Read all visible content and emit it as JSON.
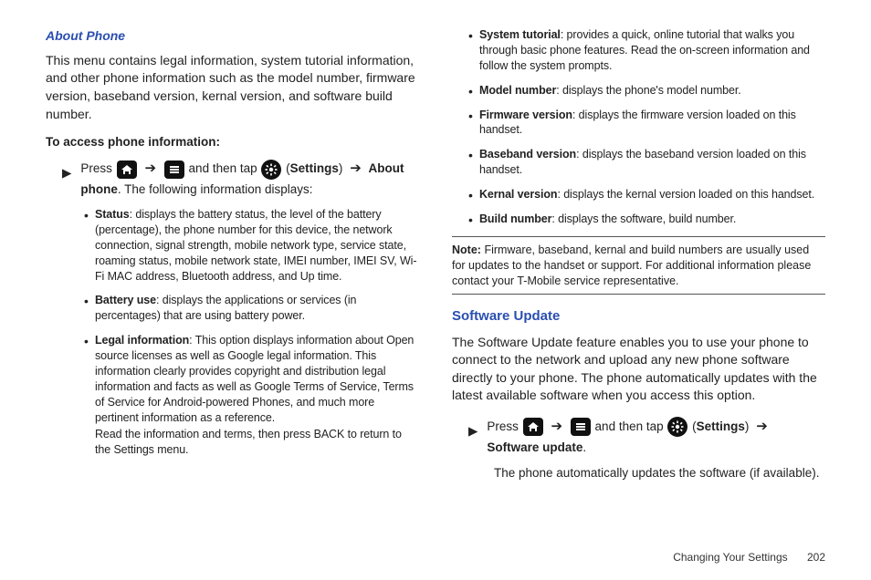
{
  "left": {
    "heading": "About Phone",
    "intro": "This menu contains legal information, system tutorial information, and other phone information such as the model number, firmware version, baseband version, kernal version, and software build number.",
    "access_heading": "To access phone information:",
    "press": "Press",
    "and_then_tap": "and then tap",
    "paren_open": "(",
    "settings_label": "Settings",
    "paren_close": ")",
    "arrow": "➔",
    "about_phone_bold": "About phone",
    "following": ". The following information displays:",
    "bullets": [
      {
        "title": "Status",
        "text": ": displays the battery status, the level of the battery (percentage), the phone number for this device, the network connection, signal strength, mobile network type, service state, roaming status, mobile network state, IMEI number, IMEI SV, Wi-Fi MAC address, Bluetooth address, and Up time."
      },
      {
        "title": "Battery use",
        "text": ": displays the applications or services (in percentages) that are using battery power."
      },
      {
        "title": "Legal information",
        "text": ": This option displays information about Open source licenses as well as Google legal information. This information clearly provides copyright and distribution legal information and facts as well as Google Terms of Service, Terms of Service for Android-powered Phones, and much more pertinent information as a reference.",
        "extra": "Read the information and terms, then press BACK to return to the Settings menu."
      }
    ]
  },
  "right": {
    "bullets": [
      {
        "title": "System tutorial",
        "text": ": provides a quick, online tutorial that walks you through basic phone features. Read the on-screen information and follow the system prompts."
      },
      {
        "title": "Model number",
        "text": ": displays the phone's model number."
      },
      {
        "title": "Firmware version",
        "text": ": displays the firmware version loaded on this handset."
      },
      {
        "title": "Baseband version",
        "text": ": displays the baseband version loaded on this handset."
      },
      {
        "title": "Kernal version",
        "text": ": displays the kernal version loaded on this handset."
      },
      {
        "title": "Build number",
        "text": ": displays the software, build number."
      }
    ],
    "note_label": "Note:",
    "note_text": "Firmware, baseband, kernal and build numbers are usually used for updates to the handset or support. For additional information please contact your T-Mobile service representative.",
    "su_heading": "Software Update",
    "su_intro": "The Software Update feature enables you to use your phone to connect to the network and upload any new phone software directly to your phone. The phone automatically updates with the latest available software when you access this option.",
    "press": "Press",
    "and_then_tap": "and then tap",
    "paren_open": "(",
    "settings_label": "Settings",
    "paren_close": ")",
    "arrow": "➔",
    "su_bold": "Software update",
    "period": ".",
    "su_cont": "The phone automatically updates the software (if available)."
  },
  "footer": {
    "section": "Changing Your Settings",
    "page": "202"
  },
  "icons": {
    "home": "home-icon",
    "menu": "menu-icon",
    "settings": "settings-icon",
    "marker": "▶"
  }
}
